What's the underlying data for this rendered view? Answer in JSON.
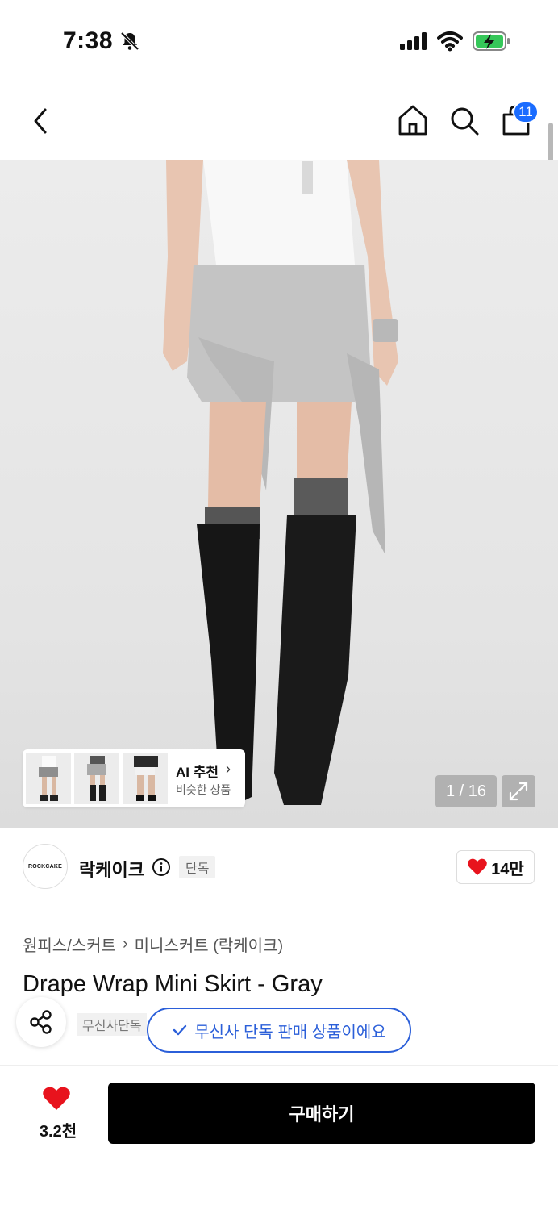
{
  "status": {
    "time": "7:38"
  },
  "nav": {
    "cart_count": "11"
  },
  "hero": {
    "ai_title": "AI 추천",
    "ai_sub": "비슷한 상품",
    "page_current": "1",
    "page_total": "16",
    "page_label": "1 / 16"
  },
  "brand": {
    "logo_text": "ROCKCAKE",
    "name": "락케이크",
    "tag": "단독",
    "likes": "14만"
  },
  "product": {
    "category": "원피스/스커트",
    "subcategory": "미니스커트 (락케이크)",
    "title": "Drape Wrap Mini Skirt - Gray",
    "tag_exclusive": "무신사단독",
    "toast": "무신사 단독 판매 상품이에요"
  },
  "bottom": {
    "heart_count": "3.2천",
    "buy_label": "구매하기"
  },
  "colors": {
    "accent_blue": "#2b5fd9",
    "badge_blue": "#1a6cff",
    "heart_red": "#e8131d",
    "buy_black": "#000000"
  }
}
